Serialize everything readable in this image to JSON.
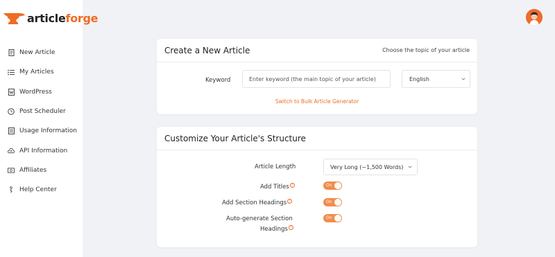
{
  "brand": {
    "part1": "article",
    "part2": "forge",
    "accent": "#ef6c24"
  },
  "sidebar": {
    "items": [
      {
        "label": "New Article",
        "icon": "document-icon"
      },
      {
        "label": "My Articles",
        "icon": "list-icon"
      },
      {
        "label": "WordPress",
        "icon": "wordpress-icon"
      },
      {
        "label": "Post Scheduler",
        "icon": "clock-icon"
      },
      {
        "label": "Usage Information",
        "icon": "usage-icon"
      },
      {
        "label": "API Information",
        "icon": "cloud-icon"
      },
      {
        "label": "Affiliates",
        "icon": "money-icon"
      },
      {
        "label": "Help Center",
        "icon": "help-icon"
      }
    ]
  },
  "create": {
    "title": "Create a New Article",
    "subtitle": "Choose the topic of your article",
    "keyword_label": "Keyword",
    "keyword_placeholder": "Enter keyword (the main topic of your article)",
    "language": "English",
    "bulk_link": "Switch to Bulk Article Generator"
  },
  "structure": {
    "title": "Customize Your Article's Structure",
    "length_label": "Article Length",
    "length_value": "Very Long (~1,500 Words)",
    "titles_label": "Add Titles",
    "headings_label": "Add Section Headings",
    "autogen_label_1": "Auto-generate Section",
    "autogen_label_2": "Headings",
    "toggle_on": "On",
    "help_glyph": "?"
  }
}
